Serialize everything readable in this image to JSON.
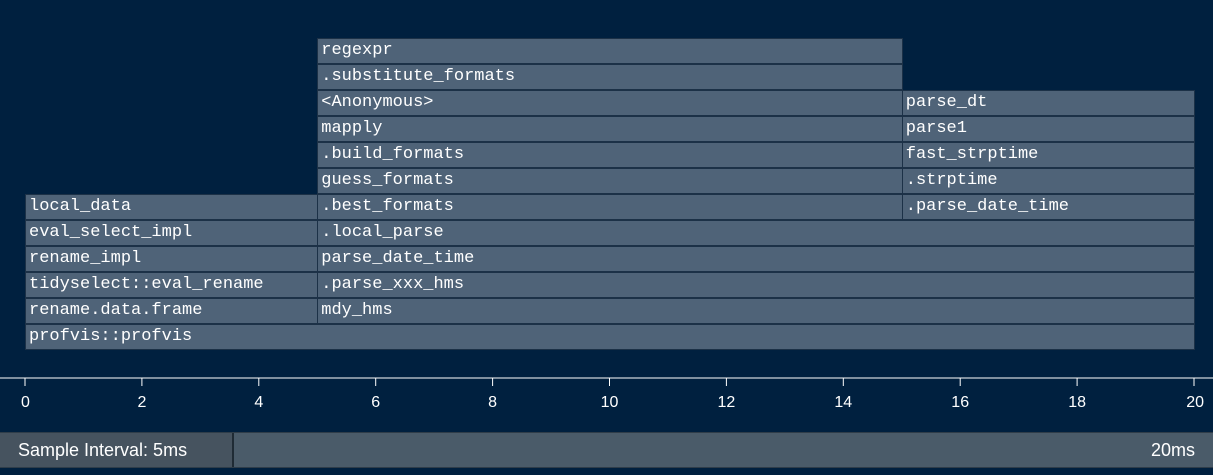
{
  "flamegraph": {
    "time_unit": "ms",
    "x_range": [
      0,
      20
    ],
    "frames": [
      {
        "label": "profvis::profvis",
        "start": 0,
        "end": 20,
        "depth": 0
      },
      {
        "label": "rename.data.frame",
        "start": 0,
        "end": 5,
        "depth": 1
      },
      {
        "label": "tidyselect::eval_rename",
        "start": 0,
        "end": 5,
        "depth": 2
      },
      {
        "label": "rename_impl",
        "start": 0,
        "end": 5,
        "depth": 3
      },
      {
        "label": "eval_select_impl",
        "start": 0,
        "end": 5,
        "depth": 4
      },
      {
        "label": "local_data",
        "start": 0,
        "end": 5,
        "depth": 5
      },
      {
        "label": "mdy_hms",
        "start": 5,
        "end": 20,
        "depth": 1
      },
      {
        "label": ".parse_xxx_hms",
        "start": 5,
        "end": 20,
        "depth": 2
      },
      {
        "label": "parse_date_time",
        "start": 5,
        "end": 20,
        "depth": 3
      },
      {
        "label": ".local_parse",
        "start": 5,
        "end": 20,
        "depth": 4
      },
      {
        "label": ".best_formats",
        "start": 5,
        "end": 15,
        "depth": 5
      },
      {
        "label": "guess_formats",
        "start": 5,
        "end": 15,
        "depth": 6
      },
      {
        "label": ".build_formats",
        "start": 5,
        "end": 15,
        "depth": 7
      },
      {
        "label": "mapply",
        "start": 5,
        "end": 15,
        "depth": 8
      },
      {
        "label": "<Anonymous>",
        "start": 5,
        "end": 15,
        "depth": 9
      },
      {
        "label": ".substitute_formats",
        "start": 5,
        "end": 15,
        "depth": 10
      },
      {
        "label": "regexpr",
        "start": 5,
        "end": 15,
        "depth": 11
      },
      {
        "label": ".parse_date_time",
        "start": 15,
        "end": 20,
        "depth": 5
      },
      {
        "label": ".strptime",
        "start": 15,
        "end": 20,
        "depth": 6
      },
      {
        "label": "fast_strptime",
        "start": 15,
        "end": 20,
        "depth": 7
      },
      {
        "label": "parse1",
        "start": 15,
        "end": 20,
        "depth": 8
      },
      {
        "label": "parse_dt",
        "start": 15,
        "end": 20,
        "depth": 9
      }
    ]
  },
  "axis": {
    "ticks": [
      "0",
      "2",
      "4",
      "6",
      "8",
      "10",
      "12",
      "14",
      "16",
      "18",
      "20"
    ]
  },
  "status": {
    "sample_interval": "Sample Interval: 5ms",
    "total_time": "20ms"
  },
  "colors": {
    "background": "#00203f",
    "frame_fill": "#4f6378",
    "frame_border": "#1c3147",
    "text": "#ffffff"
  }
}
